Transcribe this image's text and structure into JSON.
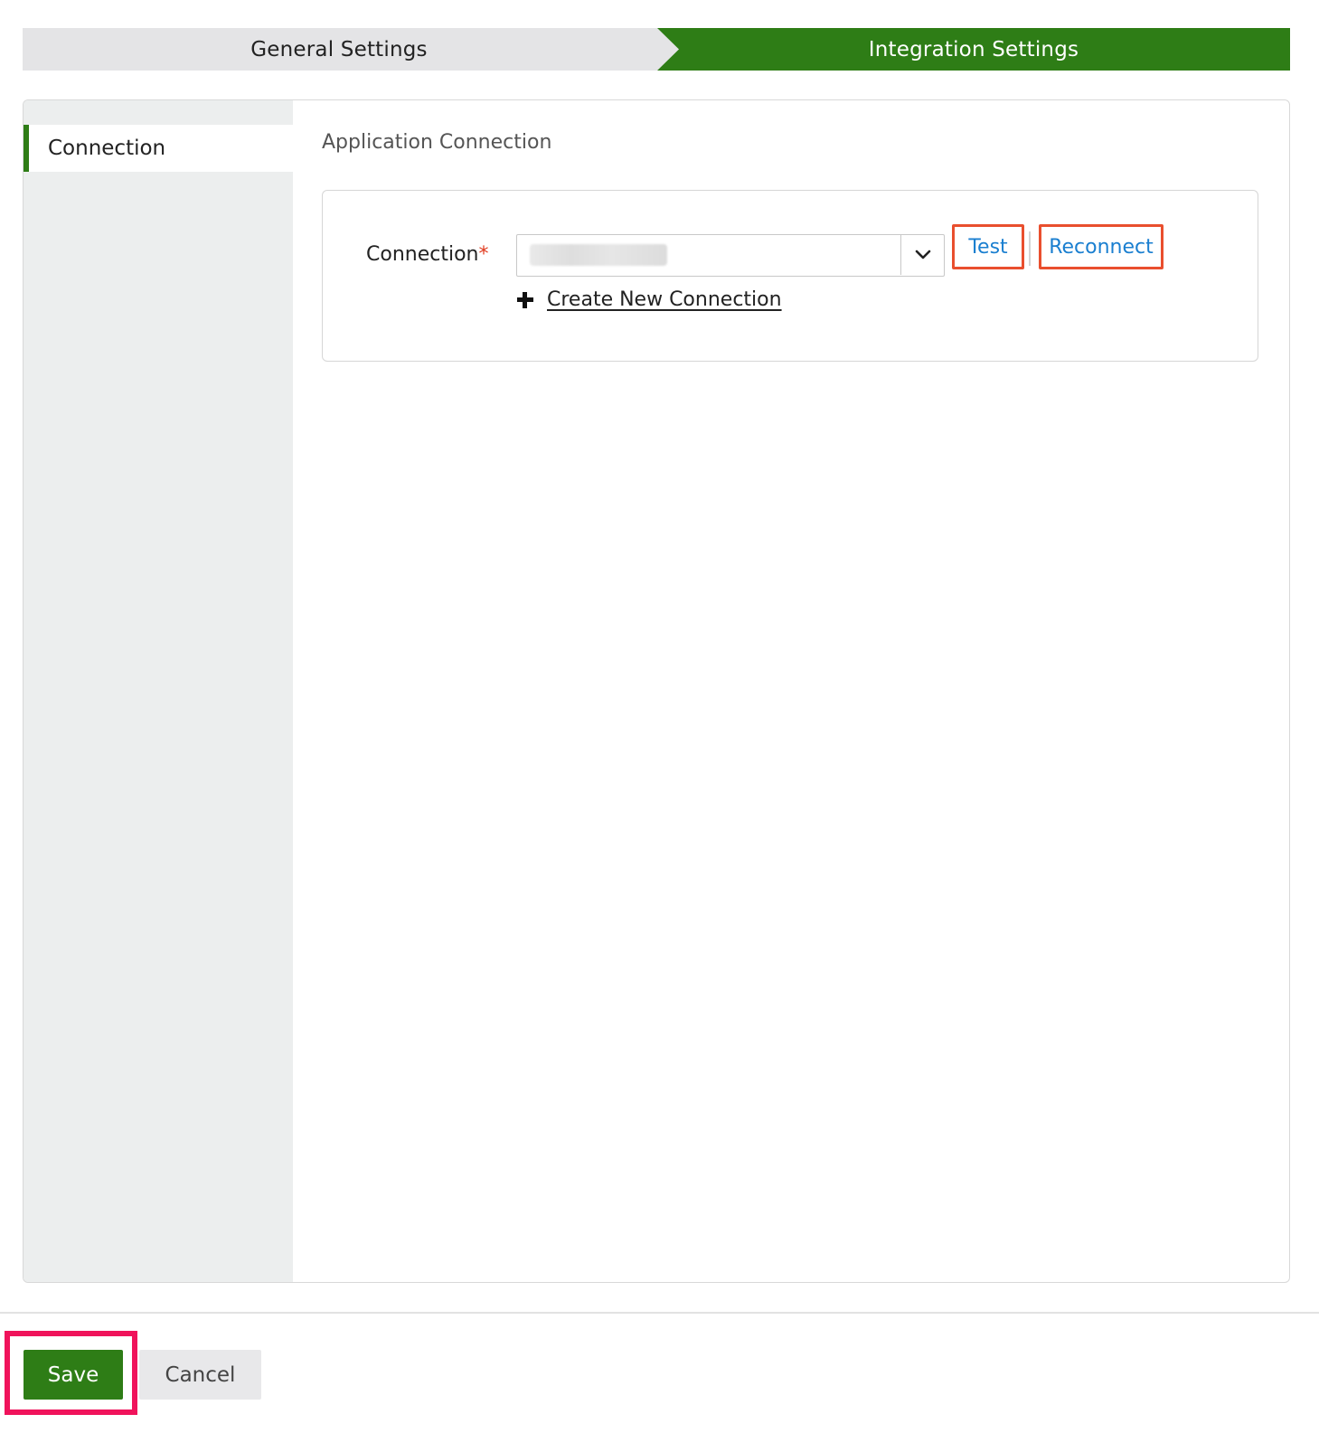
{
  "stepper": {
    "steps": [
      {
        "label": "General Settings",
        "state": "completed"
      },
      {
        "label": "Integration Settings",
        "state": "active"
      }
    ]
  },
  "sidebar": {
    "items": [
      {
        "label": "Connection",
        "selected": true
      }
    ]
  },
  "section": {
    "title": "Application Connection"
  },
  "connection_field": {
    "label": "Connection",
    "required_marker": "*",
    "selected_value": "",
    "test_label": "Test",
    "reconnect_label": "Reconnect",
    "create_label": "Create New Connection"
  },
  "footer": {
    "save_label": "Save",
    "cancel_label": "Cancel"
  },
  "colors": {
    "accent_green": "#2e7d16",
    "link_blue": "#1a7fd0",
    "annotation_orange": "#e94f2e",
    "annotation_pink": "#f0135b",
    "required_red": "#e03a1e"
  }
}
